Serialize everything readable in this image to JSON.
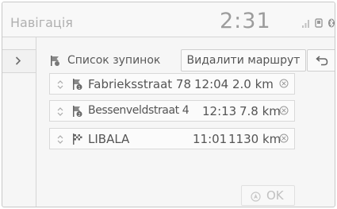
{
  "header": {
    "title": "Навігація",
    "clock": "2:31",
    "status_icons": [
      "signal-icon",
      "phone-icon",
      "bluetooth-icon"
    ]
  },
  "toolbar": {
    "stop_list_label": "Список зупинок",
    "delete_route_label": "Видалити маршрут"
  },
  "stops": [
    {
      "name": "Fabrieksstraat 78",
      "time": "12:04",
      "distance": "2.0 km",
      "icon": "waypoint-1-icon"
    },
    {
      "name": "Bessenveldstraat 4",
      "time": "12:13",
      "distance": "7.8 km",
      "icon": "waypoint-2-icon"
    },
    {
      "name": "LIBALA",
      "time": "11:01",
      "distance": "1130 km",
      "icon": "destination-flag-icon"
    }
  ],
  "footer": {
    "ok_label": "OK"
  },
  "colors": {
    "text": "#555555",
    "muted": "#b0b0b0",
    "border": "#d6d6d6"
  }
}
